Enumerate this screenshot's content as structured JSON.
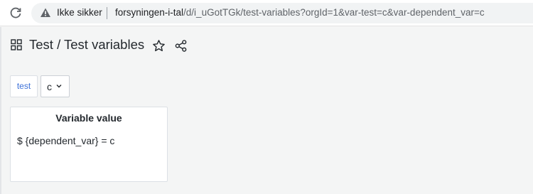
{
  "browser": {
    "security_label": "Ikke sikker",
    "url_host": "forsyningen-i-tal",
    "url_rest": "/d/i_uGotTGk/test-variables?orgId=1&var-test=c&var-dependent_var=c"
  },
  "header": {
    "title": "Test / Test variables"
  },
  "variables": {
    "label": "test",
    "selected_value": "c"
  },
  "panel": {
    "title": "Variable value",
    "body": "$ {dependent_var} = c"
  },
  "colors": {
    "accent": "#3d71d9",
    "text": "#24292e",
    "background": "#f4f5f5"
  }
}
